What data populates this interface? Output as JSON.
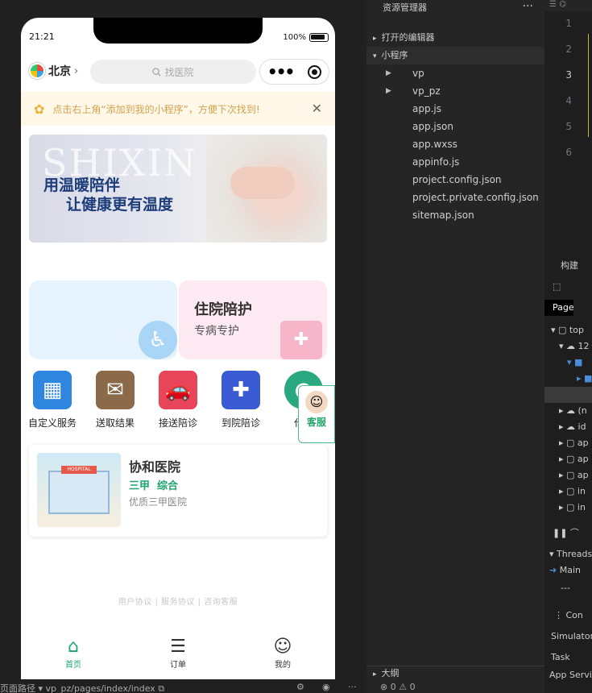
{
  "phone": {
    "status_time": "21:21",
    "battery": "100%",
    "city": "北京",
    "search_placeholder": "找医院",
    "tip": "点击右上角“添加到我的小程序”，方便下次找到!",
    "banner_watermark": "SHIXIN",
    "banner_line1": "用温暖陪伴",
    "banner_line2": "让健康更有温度",
    "card_b_title": "住院陪护",
    "card_b_sub": "专病专护",
    "services": [
      {
        "label": "自定义服务",
        "icon": "box-icon",
        "color": "#2e86de"
      },
      {
        "label": "送取结果",
        "icon": "courier-icon",
        "color": "#6d4c2f"
      },
      {
        "label": "接送陪诊",
        "icon": "car-person-icon",
        "color": "#e8445a"
      },
      {
        "label": "到院陪诊",
        "icon": "nurse-icon",
        "color": "#3b5bd4"
      },
      {
        "label": "代找",
        "icon": "agent-icon",
        "color": "#2aa880"
      }
    ],
    "kefu_label": "客服",
    "hospital": {
      "name": "协和医院",
      "tags": "三甲  综合",
      "desc": "优质三甲医院",
      "sign": "HOSPITAL"
    },
    "footer_links": "用户协议 | 服务协议 | 咨询客服",
    "tabs": [
      {
        "label": "首页",
        "icon": "home-icon"
      },
      {
        "label": "订单",
        "icon": "order-icon"
      },
      {
        "label": "我的",
        "icon": "profile-icon"
      }
    ]
  },
  "explorer": {
    "title": "资源管理器",
    "open_editors": "打开的编辑器",
    "project": "小程序",
    "files": [
      {
        "name": "vp",
        "folder": true
      },
      {
        "name": "vp_pz",
        "folder": true
      },
      {
        "name": "app.js",
        "folder": false
      },
      {
        "name": "app.json",
        "folder": false
      },
      {
        "name": "app.wxss",
        "folder": false
      },
      {
        "name": "appinfo.js",
        "folder": false
      },
      {
        "name": "project.config.json",
        "folder": false
      },
      {
        "name": "project.private.config.json",
        "folder": false
      },
      {
        "name": "sitemap.json",
        "folder": false
      }
    ],
    "outline": "大纲"
  },
  "editor": {
    "line_numbers": [
      "1",
      "2",
      "3",
      "4",
      "5",
      "6"
    ]
  },
  "devtools": {
    "build": "构建",
    "page_tab": "Page",
    "tree": [
      "top",
      "12",
      "(n",
      "id",
      "ap",
      "ap",
      "ap",
      "in",
      "in"
    ],
    "threads": "Threads",
    "main": "Main",
    "dashes": "---",
    "console": "Con",
    "simulator": "Simulator",
    "task": "Task",
    "app_service": "App Servi"
  },
  "statusbar": {
    "page_path_label": "页面路径",
    "page_path": "vp_pz/pages/index/index",
    "errors": "0",
    "warnings": "0"
  }
}
